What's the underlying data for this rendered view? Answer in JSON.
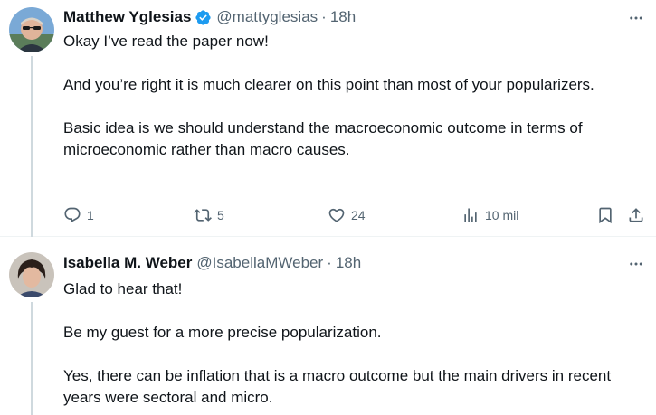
{
  "tweets": [
    {
      "author": {
        "name": "Matthew Yglesias",
        "handle": "@mattyglesias",
        "verified": true,
        "avatar_icon": "avatar-photo-man-sunglasses"
      },
      "separator": "·",
      "time": "18h",
      "paragraphs": [
        "Okay I’ve read the paper now!",
        "And you’re right it is much clearer on this point than most of your popularizers.",
        "Basic idea is we should understand the macroeconomic outcome in terms of microeconomic rather than macro causes."
      ],
      "actions": {
        "replies": "1",
        "reposts": "5",
        "likes": "24",
        "views": "10 mil"
      }
    },
    {
      "author": {
        "name": "Isabella M. Weber",
        "handle": "@IsabellaMWeber",
        "verified": false,
        "avatar_icon": "avatar-photo-woman"
      },
      "separator": "·",
      "time": "18h",
      "paragraphs": [
        "Glad to hear that!",
        "Be my guest for a more precise popularization.",
        "Yes, there can be inflation that is a macro outcome but the main drivers in recent years were sectoral and micro."
      ]
    }
  ],
  "colors": {
    "text_primary": "#0f1419",
    "text_secondary": "#536471",
    "verified_blue": "#1d9bf0",
    "thread_line": "#cfd9de",
    "divider": "#eff3f4"
  }
}
